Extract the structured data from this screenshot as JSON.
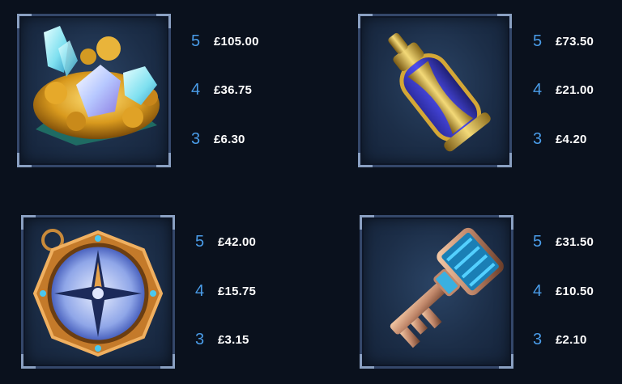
{
  "paytable": [
    {
      "symbol": "gold-crystals",
      "pays": [
        {
          "count": "5",
          "amount": "£105.00"
        },
        {
          "count": "4",
          "amount": "£36.75"
        },
        {
          "count": "3",
          "amount": "£6.30"
        }
      ]
    },
    {
      "symbol": "hourglass-bottle",
      "pays": [
        {
          "count": "5",
          "amount": "£73.50"
        },
        {
          "count": "4",
          "amount": "£21.00"
        },
        {
          "count": "3",
          "amount": "£4.20"
        }
      ]
    },
    {
      "symbol": "compass",
      "pays": [
        {
          "count": "5",
          "amount": "£42.00"
        },
        {
          "count": "4",
          "amount": "£15.75"
        },
        {
          "count": "3",
          "amount": "£3.15"
        }
      ]
    },
    {
      "symbol": "key",
      "pays": [
        {
          "count": "5",
          "amount": "£31.50"
        },
        {
          "count": "4",
          "amount": "£10.50"
        },
        {
          "count": "3",
          "amount": "£2.10"
        }
      ]
    }
  ],
  "colors": {
    "background": "#0a111d",
    "count": "#4a9ce8",
    "amount": "#ffffff",
    "frame": "#34476a"
  }
}
